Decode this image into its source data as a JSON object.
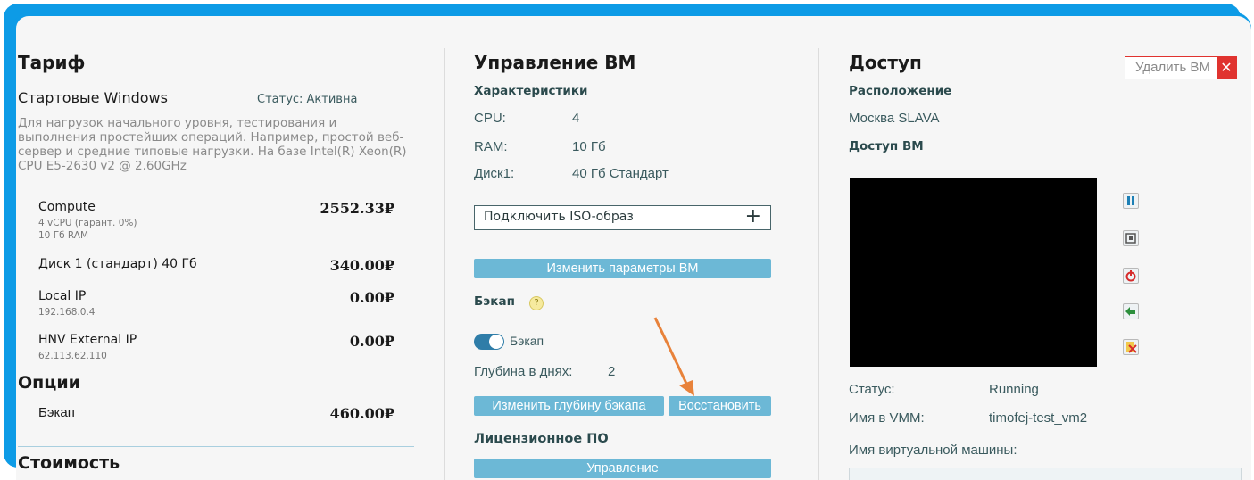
{
  "tariff": {
    "title": "Тариф",
    "plan_name": "Стартовые Windows",
    "status": "Статус: Активна",
    "description": "Для нагрузок начального уровня, тестирования и выполнения простейших операций. Например, простой веб-сервер и средние типовые нагрузки. На базе Intel(R) Xeon(R) CPU E5-2630 v2 @ 2.60GHz",
    "items": [
      {
        "name": "Compute",
        "details": [
          "4 vCPU (гарант. 0%)",
          "10 Гб RAM"
        ],
        "price": "2552.33₽"
      },
      {
        "name": "Диск 1 (стандарт) 40 Гб",
        "details": [],
        "price": "340.00₽"
      },
      {
        "name": "Local IP",
        "details": [
          "192.168.0.4"
        ],
        "price": "0.00₽"
      },
      {
        "name": "HNV External IP",
        "details": [
          "62.113.62.110"
        ],
        "price": "0.00₽"
      }
    ],
    "options_title": "Опции",
    "options": [
      {
        "name": "Бэкап",
        "price": "460.00₽"
      }
    ],
    "cost_title": "Стоимость"
  },
  "vm_management": {
    "title": "Управление ВМ",
    "specs_title": "Характеристики",
    "specs": [
      {
        "label": "CPU:",
        "value": "4"
      },
      {
        "label": "RAM:",
        "value": "10 Гб"
      },
      {
        "label": "Диск1:",
        "value": "40 Гб Стандарт"
      }
    ],
    "iso_label": "Подключить ISO-образ",
    "iso_plus": "+",
    "change_params_button": "Изменить параметры ВМ",
    "backup_title": "Бэкап",
    "help_icon": "?",
    "backup_toggle_label": "Бэкап",
    "backup_enabled": true,
    "depth_label": "Глубина в днях:",
    "depth_value": "2",
    "change_depth_button": "Изменить глубину бэкапа",
    "restore_button": "Восстановить",
    "license_title": "Лицензионное ПО",
    "manage_button": "Управление"
  },
  "access": {
    "title": "Доступ",
    "delete_button": "Удалить ВМ",
    "delete_icon": "✕",
    "location_title": "Расположение",
    "location_value": "Москва SLAVA",
    "vm_access_title": "Доступ ВМ",
    "status_label": "Статус:",
    "status_value": "Running",
    "vmm_name_label": "Имя в VMM:",
    "vmm_name_value": "timofej-test_vm2",
    "vm_name_label": "Имя виртуальной машины:",
    "vm_name_value": ""
  },
  "controls": [
    "pause-icon",
    "stop-icon",
    "restart-icon",
    "revert-icon",
    "remove-icon"
  ],
  "colors": {
    "frame": "#0d9be6",
    "panel": "#f6f6f6",
    "button": "#6cb8d6",
    "delete_red": "#e0332f",
    "arrow": "#e8823a"
  }
}
